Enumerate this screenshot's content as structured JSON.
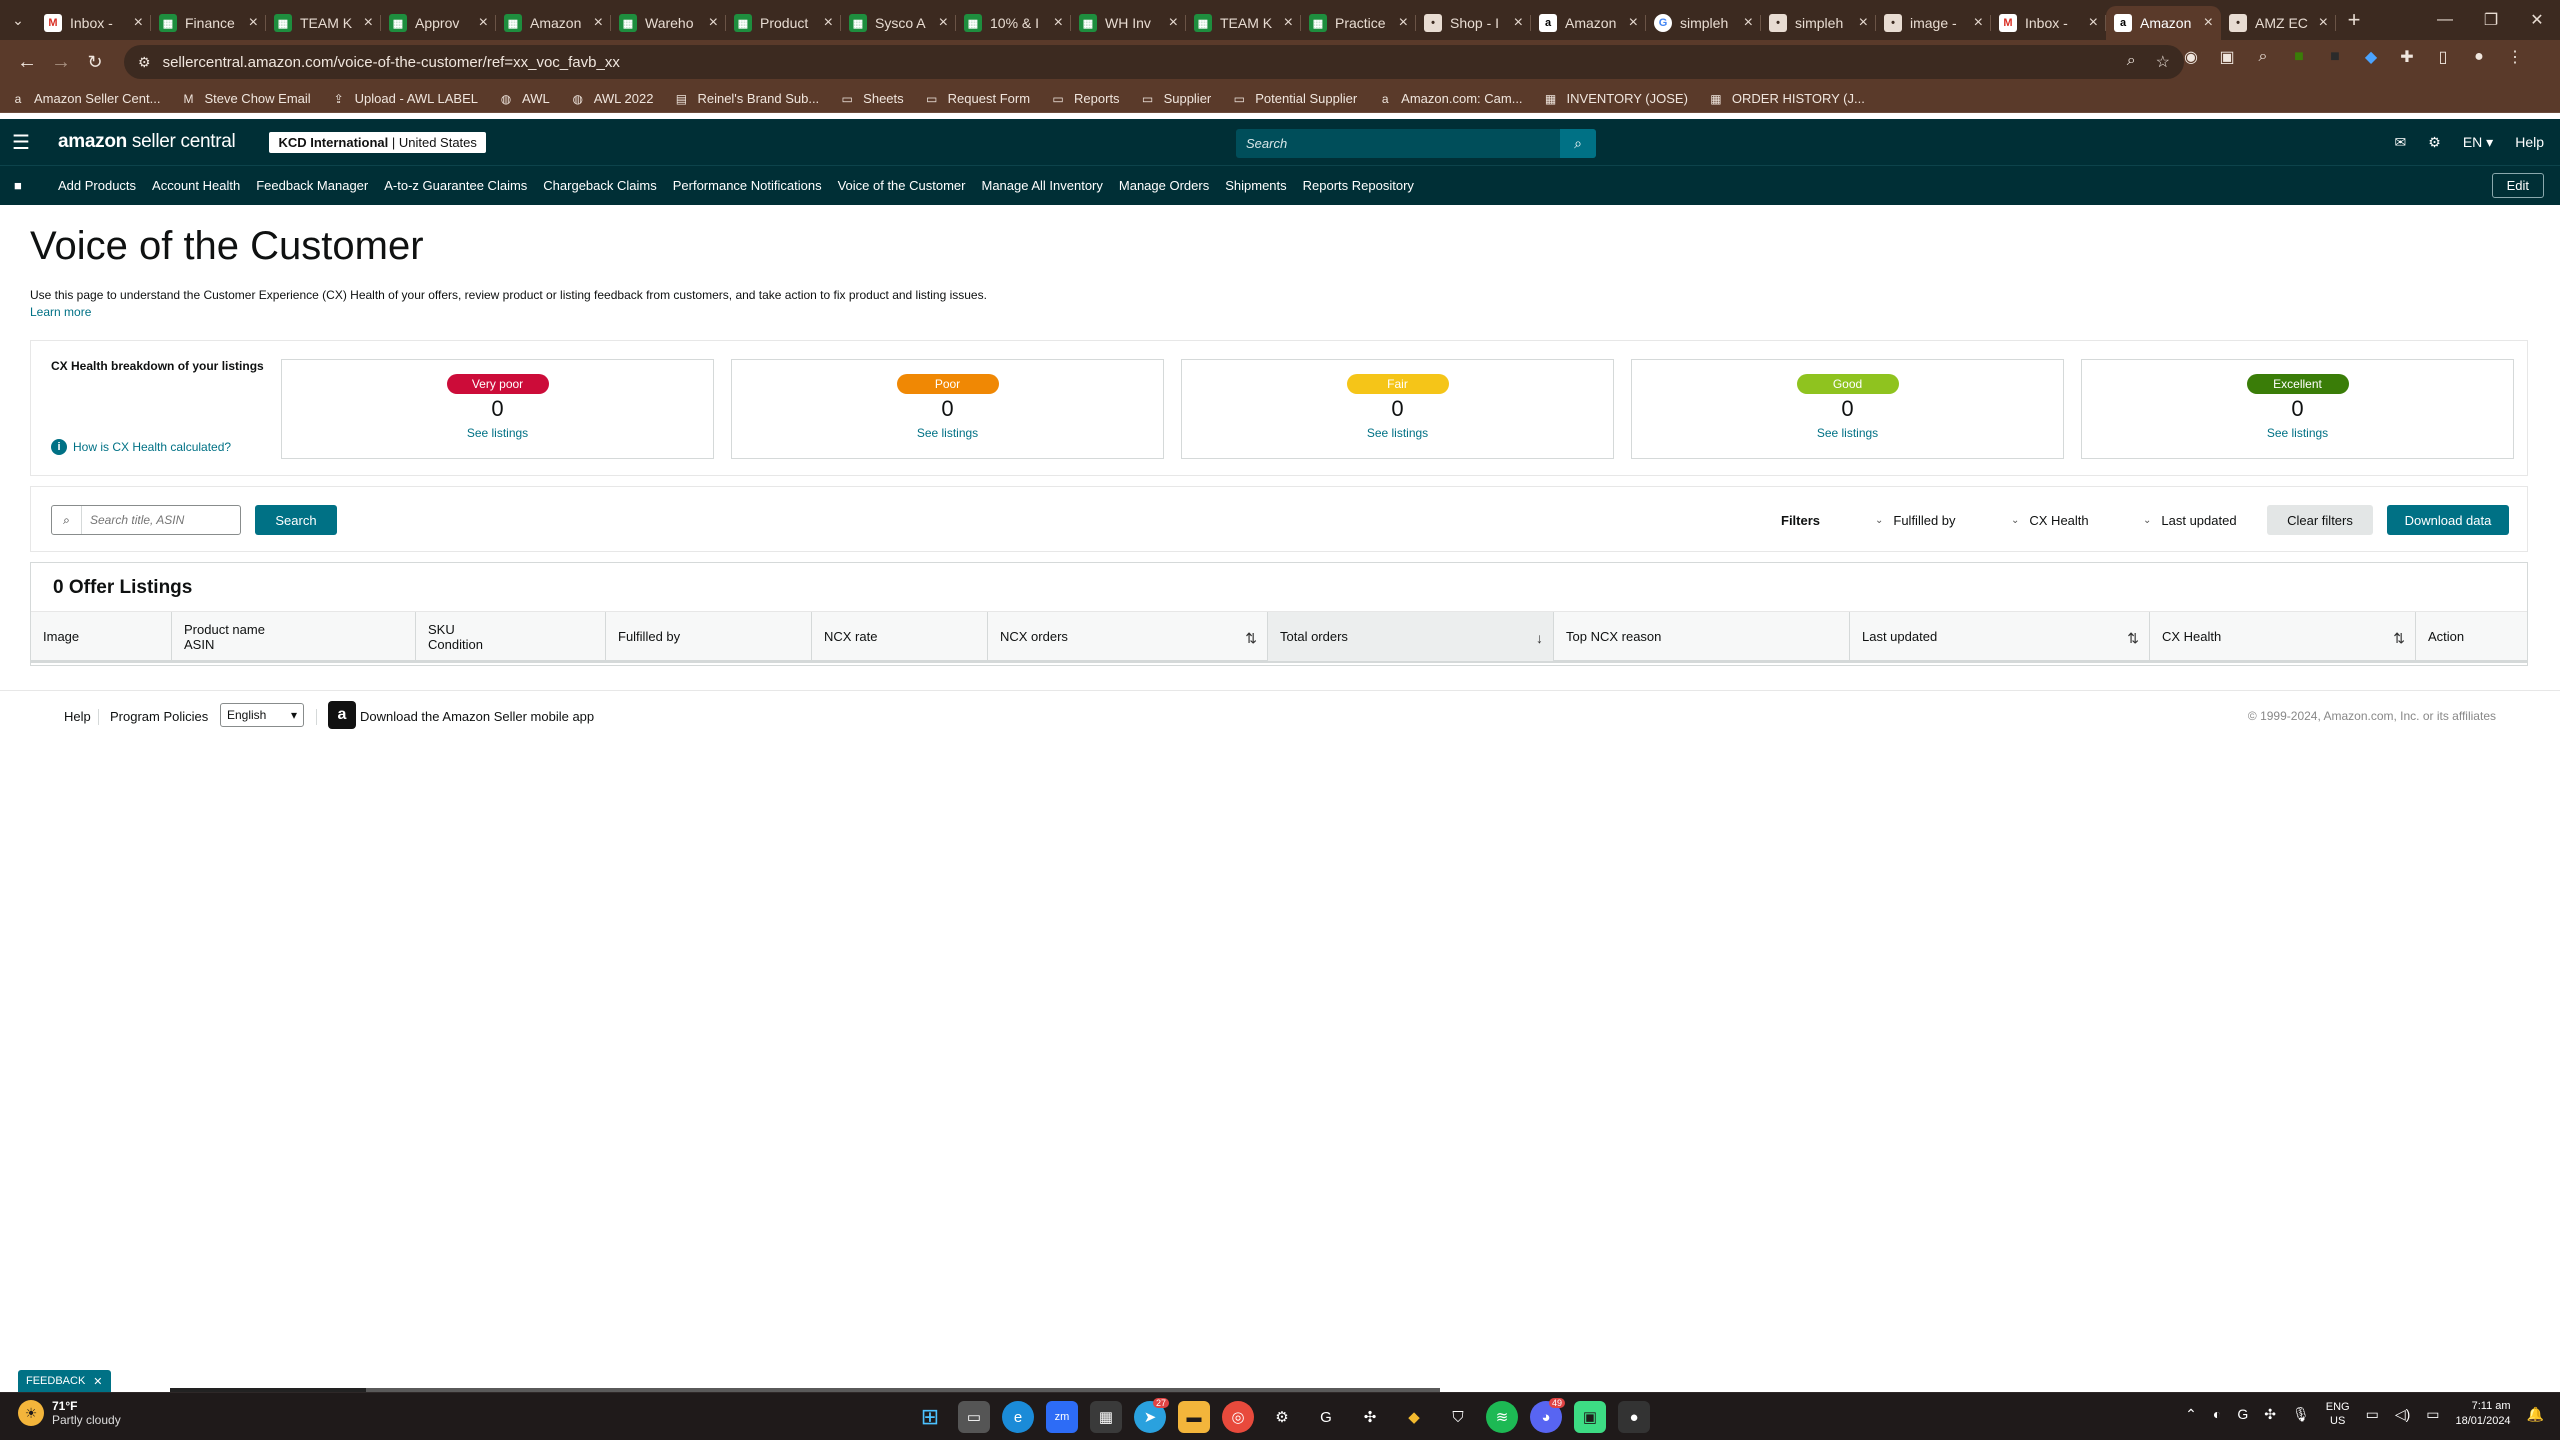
{
  "browser": {
    "tabs": [
      {
        "title": "Inbox -",
        "favicon": "gmail-icon",
        "active": false
      },
      {
        "title": "Finance",
        "favicon": "sheets-icon",
        "active": false
      },
      {
        "title": "TEAM K",
        "favicon": "sheets-icon",
        "active": false
      },
      {
        "title": "Approv",
        "favicon": "sheets-icon",
        "active": false
      },
      {
        "title": "Amazon",
        "favicon": "sheets-icon",
        "active": false
      },
      {
        "title": "Wareho",
        "favicon": "sheets-icon",
        "active": false
      },
      {
        "title": "Product",
        "favicon": "sheets-icon",
        "active": false
      },
      {
        "title": "Sysco A",
        "favicon": "sheets-icon",
        "active": false
      },
      {
        "title": "10% & I",
        "favicon": "sheets-icon",
        "active": false
      },
      {
        "title": "WH Inv",
        "favicon": "sheets-icon",
        "active": false
      },
      {
        "title": "TEAM K",
        "favicon": "sheets-icon",
        "active": false
      },
      {
        "title": "Practice",
        "favicon": "sheets-icon",
        "active": false
      },
      {
        "title": "Shop - I",
        "favicon": "shop-icon",
        "active": false
      },
      {
        "title": "Amazon",
        "favicon": "amazon-icon",
        "active": false
      },
      {
        "title": "simpleh",
        "favicon": "google-icon",
        "active": false
      },
      {
        "title": "simpleh",
        "favicon": "simpleh-icon",
        "active": false
      },
      {
        "title": "image -",
        "favicon": "image-icon",
        "active": false
      },
      {
        "title": "Inbox -",
        "favicon": "gmail-icon",
        "active": false
      },
      {
        "title": "Amazon",
        "favicon": "amazon-icon",
        "active": true
      },
      {
        "title": "AMZ EC",
        "favicon": "amz-ec-icon",
        "active": false
      }
    ],
    "url": "sellercentral.amazon.com/voice-of-the-customer/ref=xx_voc_favb_xx",
    "bookmarks": [
      {
        "label": "Amazon Seller Cent...",
        "icon": "amazon-icon"
      },
      {
        "label": "Steve Chow Email",
        "icon": "gmail-icon"
      },
      {
        "label": "Upload - AWL LABEL",
        "icon": "upload-icon"
      },
      {
        "label": "AWL",
        "icon": "globe-icon"
      },
      {
        "label": "AWL 2022",
        "icon": "globe-icon"
      },
      {
        "label": "Reinel's Brand Sub...",
        "icon": "page-icon"
      },
      {
        "label": "Sheets",
        "icon": "folder-icon"
      },
      {
        "label": "Request Form",
        "icon": "folder-icon"
      },
      {
        "label": "Reports",
        "icon": "folder-icon"
      },
      {
        "label": "Supplier",
        "icon": "folder-icon"
      },
      {
        "label": "Potential Supplier",
        "icon": "folder-icon"
      },
      {
        "label": "Amazon.com: Cam...",
        "icon": "amazon-icon"
      },
      {
        "label": "INVENTORY (JOSE)",
        "icon": "sheets-icon"
      },
      {
        "label": "ORDER HISTORY (J...",
        "icon": "sheets-icon"
      }
    ]
  },
  "header": {
    "logo_amazon": "amazon",
    "logo_rest": " seller central",
    "account_name": "KCD International",
    "account_region": "United States",
    "search_placeholder": "Search",
    "language": "EN",
    "help": "Help"
  },
  "nav": {
    "links": [
      "Add Products",
      "Account Health",
      "Feedback Manager",
      "A-to-z Guarantee Claims",
      "Chargeback Claims",
      "Performance Notifications",
      "Voice of the Customer",
      "Manage All Inventory",
      "Manage Orders",
      "Shipments",
      "Reports Repository"
    ],
    "edit": "Edit"
  },
  "page": {
    "title": "Voice of the Customer",
    "description": "Use this page to understand the Customer Experience (CX) Health of your offers, review product or listing feedback from customers, and take action to fix product and listing issues.",
    "learn_more": "Learn more"
  },
  "cx_health": {
    "label": "CX Health breakdown of your listings",
    "how_link": "How is CX Health calculated?",
    "cards": [
      {
        "rating": "Very poor",
        "count": "0",
        "link": "See listings",
        "color": "#cc0c39"
      },
      {
        "rating": "Poor",
        "count": "0",
        "link": "See listings",
        "color": "#f08804"
      },
      {
        "rating": "Fair",
        "count": "0",
        "link": "See listings",
        "color": "#f5c518"
      },
      {
        "rating": "Good",
        "count": "0",
        "link": "See listings",
        "color": "#8fc31f"
      },
      {
        "rating": "Excellent",
        "count": "0",
        "link": "See listings",
        "color": "#3a7d08"
      }
    ]
  },
  "filters": {
    "search_placeholder": "Search title, ASIN",
    "search_button": "Search",
    "label": "Filters",
    "dropdowns": [
      "Fulfilled by",
      "CX Health",
      "Last updated"
    ],
    "clear": "Clear filters",
    "download": "Download data"
  },
  "table": {
    "title": "0 Offer Listings",
    "columns": [
      {
        "line1": "Image",
        "line2": ""
      },
      {
        "line1": "Product name",
        "line2": "ASIN"
      },
      {
        "line1": "SKU",
        "line2": "Condition"
      },
      {
        "line1": "Fulfilled by",
        "line2": ""
      },
      {
        "line1": "NCX rate",
        "line2": ""
      },
      {
        "line1": "NCX orders",
        "line2": ""
      },
      {
        "line1": "Total orders",
        "line2": ""
      },
      {
        "line1": "Top NCX reason",
        "line2": ""
      },
      {
        "line1": "Last updated",
        "line2": ""
      },
      {
        "line1": "CX Health",
        "line2": ""
      },
      {
        "line1": "Action",
        "line2": ""
      }
    ]
  },
  "footer": {
    "help": "Help",
    "policies": "Program Policies",
    "language": "English",
    "app": "Download the Amazon Seller mobile app",
    "copyright": "© 1999-2024, Amazon.com, Inc. or its affiliates"
  },
  "feedback": "FEEDBACK",
  "taskbar": {
    "temp": "71°F",
    "weather": "Partly cloudy",
    "lang_top": "ENG",
    "lang_bottom": "US",
    "time": "7:11 am",
    "date": "18/01/2024",
    "telegram_badge": "27",
    "discord_badge": "49"
  }
}
